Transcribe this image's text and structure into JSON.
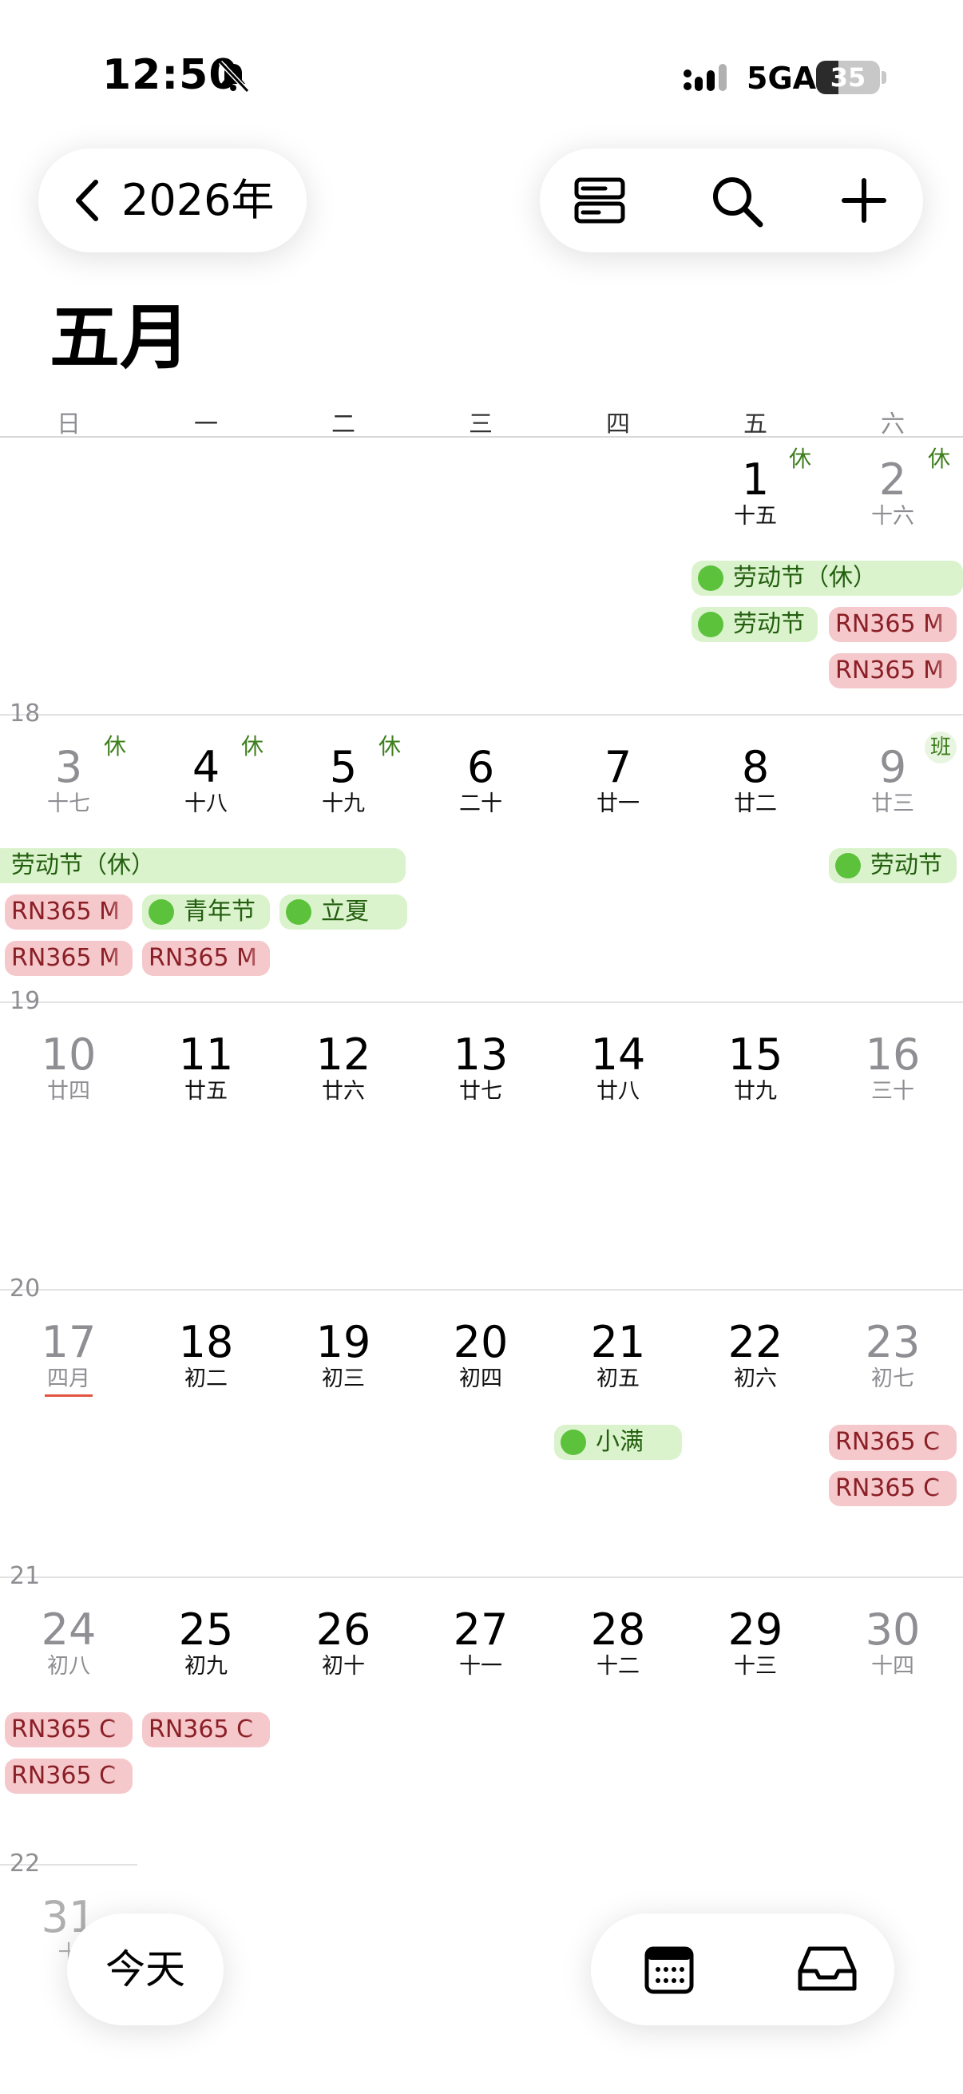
{
  "status": {
    "time": "12:50",
    "network": "5GA",
    "battery": "35",
    "battery_level": 0.35
  },
  "nav": {
    "year": "2026年"
  },
  "month": {
    "title": "五月"
  },
  "weekdays": [
    "日",
    "一",
    "二",
    "三",
    "四",
    "五",
    "六"
  ],
  "weeks": {
    "w18": {
      "number": "18"
    },
    "w19": {
      "number": "19"
    },
    "w20": {
      "number": "20"
    },
    "w21": {
      "number": "21"
    },
    "w22": {
      "number": "22"
    }
  },
  "days": {
    "d1": {
      "num": "1",
      "lunar": "十五",
      "tag": "休"
    },
    "d2": {
      "num": "2",
      "lunar": "十六",
      "tag": "休"
    },
    "d3": {
      "num": "3",
      "lunar": "十七",
      "tag": "休"
    },
    "d4": {
      "num": "4",
      "lunar": "十八",
      "tag": "休"
    },
    "d5": {
      "num": "5",
      "lunar": "十九",
      "tag": "休"
    },
    "d6": {
      "num": "6",
      "lunar": "二十"
    },
    "d7": {
      "num": "7",
      "lunar": "廿一"
    },
    "d8": {
      "num": "8",
      "lunar": "廿二"
    },
    "d9": {
      "num": "9",
      "lunar": "廿三",
      "tag": "班"
    },
    "d10": {
      "num": "10",
      "lunar": "廿四"
    },
    "d11": {
      "num": "11",
      "lunar": "廿五"
    },
    "d12": {
      "num": "12",
      "lunar": "廿六"
    },
    "d13": {
      "num": "13",
      "lunar": "廿七"
    },
    "d14": {
      "num": "14",
      "lunar": "廿八"
    },
    "d15": {
      "num": "15",
      "lunar": "廿九"
    },
    "d16": {
      "num": "16",
      "lunar": "三十"
    },
    "d17": {
      "num": "17",
      "lunar": "四月"
    },
    "d18": {
      "num": "18",
      "lunar": "初二"
    },
    "d19": {
      "num": "19",
      "lunar": "初三"
    },
    "d20": {
      "num": "20",
      "lunar": "初四"
    },
    "d21": {
      "num": "21",
      "lunar": "初五"
    },
    "d22": {
      "num": "22",
      "lunar": "初六"
    },
    "d23": {
      "num": "23",
      "lunar": "初七"
    },
    "d24": {
      "num": "24",
      "lunar": "初八"
    },
    "d25": {
      "num": "25",
      "lunar": "初九"
    },
    "d26": {
      "num": "26",
      "lunar": "初十"
    },
    "d27": {
      "num": "27",
      "lunar": "十一"
    },
    "d28": {
      "num": "28",
      "lunar": "十二"
    },
    "d29": {
      "num": "29",
      "lunar": "十三"
    },
    "d30": {
      "num": "30",
      "lunar": "十四"
    },
    "d31": {
      "num": "31",
      "lunar": "十"
    }
  },
  "events": {
    "labor_day_off": "劳动节（休）",
    "labor_day": "劳动节",
    "rn365_m": "RN365 M",
    "rn365_c": "RN365 C",
    "youth_day": "青年节",
    "lixia": "立夏",
    "xiaoman": "小满"
  },
  "bottom": {
    "today": "今天"
  },
  "colors": {
    "holiday_green": "#daf3cc",
    "event_red": "#f5c8cb",
    "today_marker": "#e35342"
  }
}
